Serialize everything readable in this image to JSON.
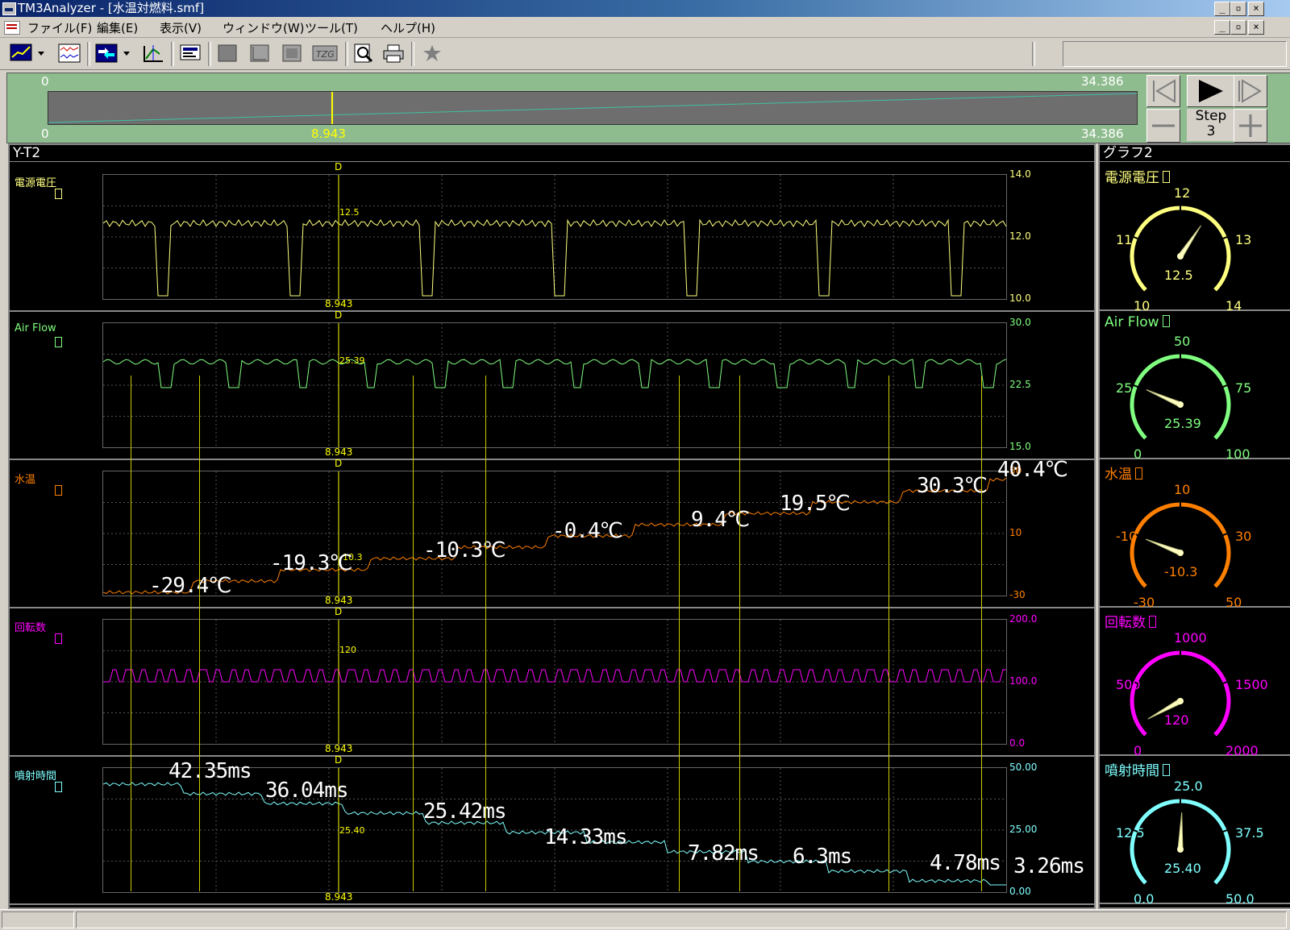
{
  "window": {
    "title": "TM3Analyzer - [水温対燃料.smf]"
  },
  "menu": {
    "items": [
      "ファイル(F)",
      "編集(E)",
      "表示(V)",
      "ウィンドウ(W)",
      "ツール(T)",
      "ヘルプ(H)"
    ]
  },
  "toolbar": {
    "icons": [
      "graph-icon",
      "dropdown-icon",
      "waveform-icon",
      "transfer-icon",
      "dropdown-icon",
      "ruler-icon",
      "monitor-icon",
      "square-icon",
      "cursor-left-icon",
      "square-outline-icon",
      "tm-icon",
      "preview-icon",
      "print-icon",
      "star-icon"
    ]
  },
  "navigator": {
    "top_left": "0",
    "top_right": "34.386",
    "bottom_left": "0",
    "cursor": "8.943",
    "bottom_right": "34.386",
    "cursor_fraction": 0.26,
    "step_label": "Step",
    "step_value": "3"
  },
  "yt_pane": {
    "title": "Y-T2",
    "cursor_marker": "D",
    "cursor_time": "8.943",
    "channels": [
      {
        "name": "電源電圧",
        "color": "#ffff80",
        "ticks": [
          "14.0",
          "12.0",
          "10.0"
        ],
        "cursor_value": "12.5",
        "annotations": []
      },
      {
        "name": "Air Flow",
        "color": "#80ff80",
        "ticks": [
          "30.0",
          "22.5",
          "15.0"
        ],
        "cursor_value": "25.39",
        "annotations": []
      },
      {
        "name": "水温",
        "color": "#ff8000",
        "ticks": [
          "50",
          "10",
          "-30"
        ],
        "cursor_value": "-10.3",
        "annotations": [
          "-29.4℃",
          "-19.3℃",
          "-10.3℃",
          "-0.4℃",
          "9.4℃",
          "19.5℃",
          "30.3℃",
          "40.4℃"
        ]
      },
      {
        "name": "回転数",
        "color": "#ff00ff",
        "ticks": [
          "200.0",
          "100.0",
          "0.0"
        ],
        "cursor_value": "120",
        "annotations": []
      },
      {
        "name": "噴射時間",
        "color": "#80ffff",
        "ticks": [
          "50.00",
          "25.00",
          "0.00"
        ],
        "cursor_value": "25.40",
        "annotations": [
          "42.35ms",
          "36.04ms",
          "25.42ms",
          "14.33ms",
          "7.82ms",
          "6.3ms",
          "4.78ms",
          "3.26ms"
        ]
      }
    ]
  },
  "gauge_pane": {
    "title": "グラフ2",
    "gauges": [
      {
        "name": "電源電圧",
        "color": "#ffff80",
        "labels": [
          "12",
          "11",
          "13",
          "10",
          "14"
        ],
        "value": "12.5",
        "min": 10,
        "max": 14,
        "reading": 12.5
      },
      {
        "name": "Air Flow",
        "color": "#80ff80",
        "labels": [
          "50",
          "25",
          "75",
          "0",
          "100"
        ],
        "value": "25.39",
        "min": 0,
        "max": 100,
        "reading": 25.39
      },
      {
        "name": "水温",
        "color": "#ff8000",
        "labels": [
          "10",
          "-10",
          "30",
          "-30",
          "50"
        ],
        "value": "-10.3",
        "min": -30,
        "max": 50,
        "reading": -10.3
      },
      {
        "name": "回転数",
        "color": "#ff00ff",
        "labels": [
          "1000",
          "500",
          "1500",
          "0",
          "2000"
        ],
        "value": "120",
        "min": 0,
        "max": 2000,
        "reading": 120
      },
      {
        "name": "噴射時間",
        "color": "#80ffff",
        "labels": [
          "25.0",
          "12.5",
          "37.5",
          "0.0",
          "50.0"
        ],
        "value": "25.40",
        "min": 0,
        "max": 50,
        "reading": 25.4
      }
    ]
  }
}
